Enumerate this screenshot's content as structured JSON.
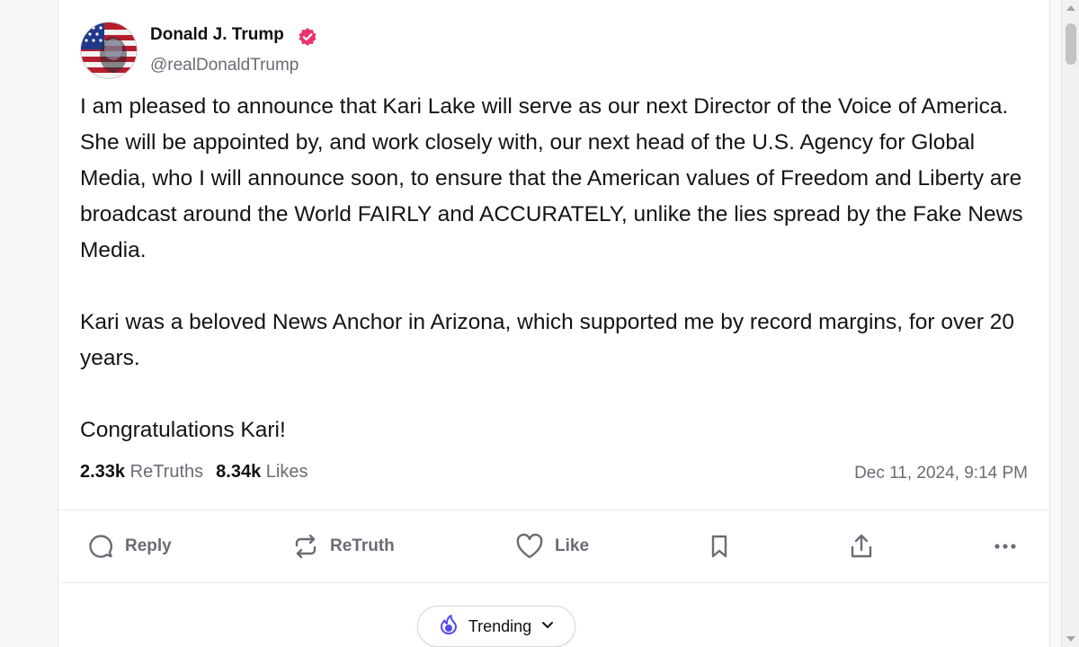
{
  "post": {
    "author": {
      "display_name": "Donald J. Trump",
      "handle": "@realDonaldTrump",
      "verified_icon": "verified-badge-icon",
      "badge_color": "#e8336d"
    },
    "paragraphs": [
      "I am pleased to announce that Kari Lake will serve as our next Director of the Voice of America. She will be appointed by, and work closely with, our next head of the U.S. Agency for Global Media, who I will announce soon, to ensure that the American values of Freedom and Liberty are broadcast around the World FAIRLY and ACCURATELY, unlike the lies spread by the Fake News Media.",
      "Kari was a beloved News Anchor in Arizona, which supported me by record margins, for over 20 years.",
      "Congratulations Kari!"
    ],
    "stats": {
      "retruths_count": "2.33k",
      "retruths_label": "ReTruths",
      "likes_count": "8.34k",
      "likes_label": "Likes"
    },
    "timestamp": "Dec 11, 2024, 9:14 PM"
  },
  "actions": {
    "reply_label": "Reply",
    "retruth_label": "ReTruth",
    "like_label": "Like",
    "bookmark_icon": "bookmark-icon",
    "share_icon": "share-icon",
    "more_icon": "more-options-icon"
  },
  "trending": {
    "label": "Trending",
    "icon": "flame-icon",
    "accent": "#5448ee"
  }
}
